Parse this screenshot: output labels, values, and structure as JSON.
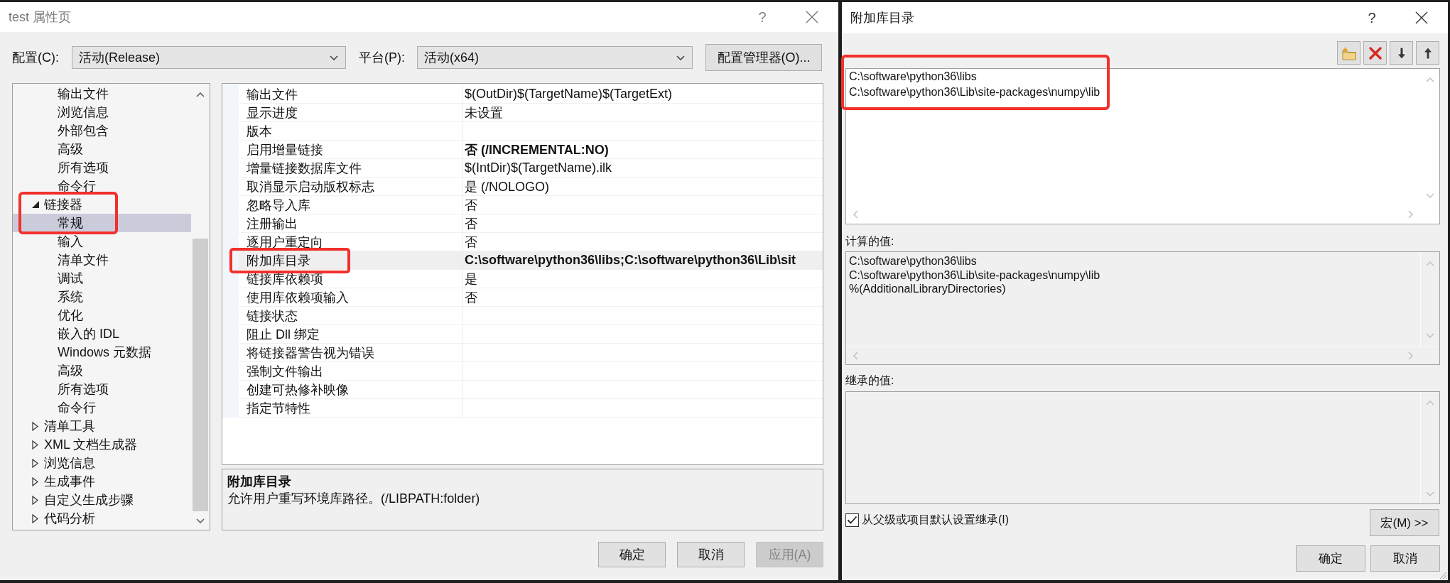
{
  "main_dialog": {
    "title": "test 属性页",
    "active": false,
    "help_button": "?",
    "config": {
      "label": "配置(C):",
      "value": "活动(Release)"
    },
    "platform": {
      "label": "平台(P):",
      "value": "活动(x64)"
    },
    "config_manager_button": "配置管理器(O)...",
    "tree": {
      "items": [
        {
          "children": [
            {
              "label": "输出文件",
              "selected": false,
              "highlighted": false
            },
            {
              "label": "浏览信息",
              "selected": false,
              "highlighted": false
            },
            {
              "label": "外部包含",
              "selected": false,
              "highlighted": false
            },
            {
              "label": "高级",
              "selected": false,
              "highlighted": false
            },
            {
              "label": "所有选项",
              "selected": false,
              "highlighted": false
            },
            {
              "label": "命令行",
              "selected": false,
              "highlighted": false
            }
          ]
        },
        {
          "label": "链接器",
          "expanded": true,
          "selected": false,
          "highlighted": true,
          "children": [
            {
              "label": "常规",
              "selected": true,
              "highlighted": true
            },
            {
              "label": "输入",
              "selected": false,
              "highlighted": false
            },
            {
              "label": "清单文件",
              "selected": false,
              "highlighted": false
            },
            {
              "label": "调试",
              "selected": false,
              "highlighted": false
            },
            {
              "label": "系统",
              "selected": false,
              "highlighted": false
            },
            {
              "label": "优化",
              "selected": false,
              "highlighted": false
            },
            {
              "label": "嵌入的 IDL",
              "selected": false,
              "highlighted": false
            },
            {
              "label": "Windows 元数据",
              "selected": false,
              "highlighted": false
            },
            {
              "label": "高级",
              "selected": false,
              "highlighted": false
            },
            {
              "label": "所有选项",
              "selected": false,
              "highlighted": false
            },
            {
              "label": "命令行",
              "selected": false,
              "highlighted": false
            }
          ]
        },
        {
          "label": "清单工具",
          "expanded": false,
          "selected": false,
          "highlighted": false
        },
        {
          "label": "XML 文档生成器",
          "expanded": false,
          "selected": false,
          "highlighted": false
        },
        {
          "label": "浏览信息",
          "expanded": false,
          "selected": false,
          "highlighted": false
        },
        {
          "label": "生成事件",
          "expanded": false,
          "selected": false,
          "highlighted": false
        },
        {
          "label": "自定义生成步骤",
          "expanded": false,
          "selected": false,
          "highlighted": false
        },
        {
          "label": "代码分析",
          "expanded": false,
          "selected": false,
          "highlighted": false
        }
      ]
    },
    "properties": {
      "rows": [
        {
          "name": "输出文件",
          "value": "$(OutDir)$(TargetName)$(TargetExt)",
          "modified": false,
          "selected": false,
          "highlighted": false
        },
        {
          "name": "显示进度",
          "value": "未设置",
          "modified": false,
          "selected": false,
          "highlighted": false
        },
        {
          "name": "版本",
          "selected": false,
          "highlighted": false
        },
        {
          "name": "启用增量链接",
          "value": "否 (/INCREMENTAL:NO)",
          "modified": true,
          "selected": false,
          "highlighted": false
        },
        {
          "name": "增量链接数据库文件",
          "value": "$(IntDir)$(TargetName).ilk",
          "modified": false,
          "selected": false,
          "highlighted": false
        },
        {
          "name": "取消显示启动版权标志",
          "value": "是 (/NOLOGO)",
          "modified": false,
          "selected": false,
          "highlighted": false
        },
        {
          "name": "忽略导入库",
          "value": "否",
          "modified": false,
          "selected": false,
          "highlighted": false
        },
        {
          "name": "注册输出",
          "value": "否",
          "modified": false,
          "selected": false,
          "highlighted": false
        },
        {
          "name": "逐用户重定向",
          "value": "否",
          "modified": false,
          "selected": false,
          "highlighted": false
        },
        {
          "name": "附加库目录",
          "value": "C:\\software\\python36\\libs;C:\\software\\python36\\Lib\\sit",
          "modified": true,
          "selected": true,
          "highlighted": true
        },
        {
          "name": "链接库依赖项",
          "value": "是",
          "modified": false,
          "selected": false,
          "highlighted": false
        },
        {
          "name": "使用库依赖项输入",
          "value": "否",
          "modified": false,
          "selected": false,
          "highlighted": false
        },
        {
          "name": "链接状态",
          "selected": false,
          "highlighted": false
        },
        {
          "name": "阻止 Dll 绑定",
          "selected": false,
          "highlighted": false
        },
        {
          "name": "将链接器警告视为错误",
          "selected": false,
          "highlighted": false
        },
        {
          "name": "强制文件输出",
          "selected": false,
          "highlighted": false
        },
        {
          "name": "创建可热修补映像",
          "selected": false,
          "highlighted": false
        },
        {
          "name": "指定节特性",
          "selected": false,
          "highlighted": false
        }
      ]
    },
    "description": {
      "title": "附加库目录",
      "text": "允许用户重写环境库路径。(/LIBPATH:folder)"
    },
    "buttons": [
      {
        "label": "确定",
        "disabled": false
      },
      {
        "label": "取消",
        "disabled": false
      },
      {
        "label": "应用(A)",
        "disabled": true
      }
    ]
  },
  "library_dialog": {
    "title": "附加库目录",
    "active": true,
    "help_button": "?",
    "entries": {
      "lines": [
        "C:\\software\\python36\\libs",
        "C:\\software\\python36\\Lib\\site-packages\\numpy\\lib"
      ],
      "highlighted": true
    },
    "computed": {
      "label": "计算的值:",
      "lines": [
        "C:\\software\\python36\\libs",
        "C:\\software\\python36\\Lib\\site-packages\\numpy\\lib",
        "%(AdditionalLibraryDirectories)"
      ]
    },
    "inherited": {
      "label": "继承的值:"
    },
    "inherit_checkbox": {
      "label": "从父级或项目默认设置继承(I)",
      "checked": true
    },
    "macro_button": "宏(M) >>",
    "buttons": [
      "确定",
      "取消"
    ]
  }
}
